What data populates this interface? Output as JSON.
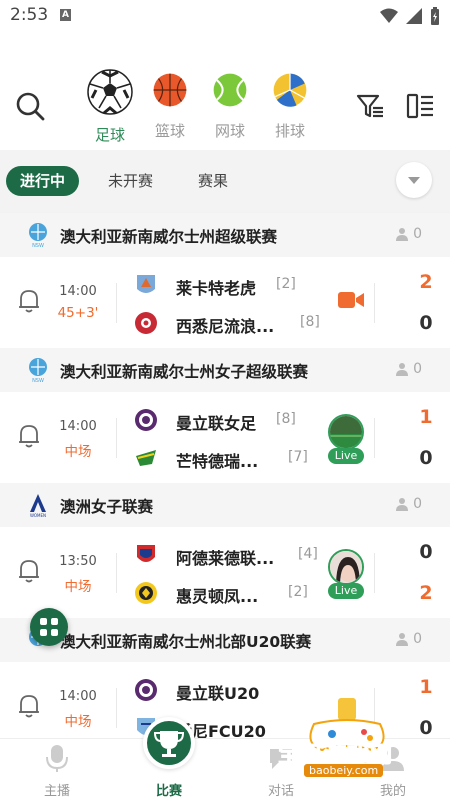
{
  "status_bar": {
    "time": "2:53",
    "notification_icon": "A"
  },
  "sports": [
    {
      "label": "足球",
      "icon": "soccer-ball-icon",
      "active": true
    },
    {
      "label": "篮球",
      "icon": "basketball-icon",
      "active": false
    },
    {
      "label": "网球",
      "icon": "tennis-ball-icon",
      "active": false
    },
    {
      "label": "排球",
      "icon": "volleyball-icon",
      "active": false
    }
  ],
  "subtabs": [
    {
      "label": "进行中",
      "active": true
    },
    {
      "label": "未开赛",
      "active": false
    },
    {
      "label": "赛果",
      "active": false
    }
  ],
  "leagues": [
    {
      "name": "澳大利亚新南威尔士州超级联赛",
      "count": "0",
      "match": {
        "time": "14:00",
        "status": "45+3'",
        "home": {
          "name": "莱卡特老虎",
          "rank": "[2]",
          "score": "2"
        },
        "away": {
          "name": "西悉尼流浪...",
          "rank": "[8]",
          "score": "0"
        },
        "media": "video"
      }
    },
    {
      "name": "澳大利亚新南威尔士州女子超级联赛",
      "count": "0",
      "match": {
        "time": "14:00",
        "status": "中场",
        "home": {
          "name": "曼立联女足",
          "rank": "[8]",
          "score": "1"
        },
        "away": {
          "name": "芒特德瑞...",
          "rank": "[7]",
          "score": "0"
        },
        "media": "live",
        "live_label": "Live"
      }
    },
    {
      "name": "澳洲女子联赛",
      "count": "0",
      "match": {
        "time": "13:50",
        "status": "中场",
        "home": {
          "name": "阿德莱德联...",
          "rank": "[4]",
          "score": "0"
        },
        "away": {
          "name": "惠灵顿凤...",
          "rank": "[2]",
          "score": "2"
        },
        "media": "live",
        "live_label": "Live"
      }
    },
    {
      "name": "澳大利亚新南威尔士州北部U20联赛",
      "count": "0",
      "match": {
        "time": "14:00",
        "status": "中场",
        "home": {
          "name": "曼立联U20",
          "rank": "",
          "score": "1"
        },
        "away": {
          "name": "悉尼FCU20",
          "rank": "",
          "score": "0"
        },
        "media": "none"
      }
    }
  ],
  "bottom_nav": [
    {
      "label": "主播",
      "active": false
    },
    {
      "label": "比赛",
      "active": true
    },
    {
      "label": "对话",
      "active": false
    },
    {
      "label": "我的",
      "active": false
    }
  ],
  "watermark": {
    "text": "宝贝游戏网",
    "url": "baobeiy.com"
  },
  "colors": {
    "brand_green": "#1c6b46",
    "accent_orange": "#f06b2f"
  }
}
